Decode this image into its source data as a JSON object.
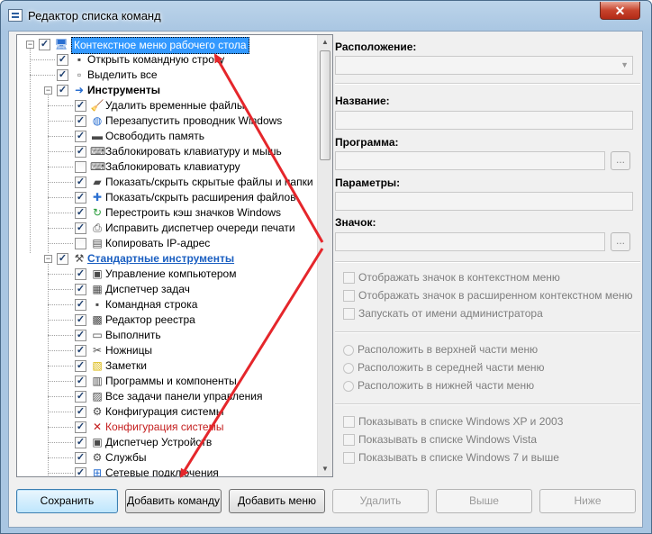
{
  "window": {
    "title": "Редактор списка команд",
    "close_label": "✕"
  },
  "tree": {
    "rows": [
      {
        "label": "Контекстное меню рабочего стола",
        "icon": "desktop-icon",
        "style": "selected"
      },
      {
        "label": "Открыть командную строку",
        "icon": "cmd-icon",
        "style": "normal"
      },
      {
        "label": "Выделить все",
        "icon": "document-icon",
        "style": "normal"
      },
      {
        "label": "Инструменты",
        "icon": "tools-arrow-icon",
        "style": "bold"
      },
      {
        "label": "Удалить временные файлы",
        "icon": "broom-icon",
        "style": "normal"
      },
      {
        "label": "Перезапустить проводник Windows",
        "icon": "globe-icon",
        "style": "normal"
      },
      {
        "label": "Освободить память",
        "icon": "memory-icon",
        "style": "normal"
      },
      {
        "label": "Заблокировать клавиатуру и мышь",
        "icon": "keyboard-mouse-icon",
        "style": "normal"
      },
      {
        "label": "Заблокировать клавиатуру",
        "icon": "keyboard-icon",
        "style": "normal"
      },
      {
        "label": "Показать/скрыть скрытые файлы и папки",
        "icon": "folder-icon",
        "style": "normal"
      },
      {
        "label": "Показать/скрыть расширения файлов",
        "icon": "puzzle-icon",
        "style": "normal"
      },
      {
        "label": "Перестроить кэш значков Windows",
        "icon": "refresh-icon",
        "style": "normal"
      },
      {
        "label": "Исправить диспетчер очереди печати",
        "icon": "printer-icon",
        "style": "normal"
      },
      {
        "label": "Копировать IP-адрес",
        "icon": "ip-icon",
        "style": "normal"
      },
      {
        "label": "Стандартные инструменты",
        "icon": "wrench-icon",
        "style": "link"
      },
      {
        "label": "Управление компьютером",
        "icon": "computer-management-icon",
        "style": "normal"
      },
      {
        "label": "Диспетчер задач",
        "icon": "task-manager-icon",
        "style": "normal"
      },
      {
        "label": "Командная строка",
        "icon": "cmd-icon",
        "style": "normal"
      },
      {
        "label": "Редактор реестра",
        "icon": "registry-icon",
        "style": "normal"
      },
      {
        "label": "Выполнить",
        "icon": "run-icon",
        "style": "normal"
      },
      {
        "label": "Ножницы",
        "icon": "scissors-icon",
        "style": "normal"
      },
      {
        "label": "Заметки",
        "icon": "sticky-note-icon",
        "style": "normal"
      },
      {
        "label": "Программы и компоненты",
        "icon": "programs-icon",
        "style": "normal"
      },
      {
        "label": "Все задачи панели управления",
        "icon": "control-panel-icon",
        "style": "normal"
      },
      {
        "label": "Конфигурация системы",
        "icon": "system-config-icon",
        "style": "normal"
      },
      {
        "label": "Конфигурация системы",
        "icon": "red-x-icon",
        "style": "red"
      },
      {
        "label": "Диспетчер Устройств",
        "icon": "device-manager-icon",
        "style": "normal"
      },
      {
        "label": "Службы",
        "icon": "services-icon",
        "style": "normal"
      },
      {
        "label": "Сетевые подключения",
        "icon": "network-icon",
        "style": "normal"
      }
    ]
  },
  "form": {
    "location_label": "Расположение:",
    "name_label": "Название:",
    "program_label": "Программа:",
    "params_label": "Параметры:",
    "icon_label": "Значок:",
    "browse_label": "...",
    "show_icon_context": "Отображать значок в контекстном меню",
    "show_icon_extended": "Отображать значок в расширенном контекстном меню",
    "run_as_admin": "Запускать от имени администратора",
    "pos_top": "Расположить в верхней части меню",
    "pos_middle": "Расположить в середней части меню",
    "pos_bottom": "Расположить в нижней части меню",
    "show_xp": "Показывать в списке Windows XP и 2003",
    "show_vista": "Показывать в списке Windows Vista",
    "show_7": "Показывать в списке Windows 7 и выше"
  },
  "buttons": {
    "save": "Сохранить",
    "add_command": "Добавить команду",
    "add_menu": "Добавить меню",
    "delete": "Удалить",
    "up": "Выше",
    "down": "Ниже"
  },
  "colors": {
    "annotation_arrow": "#e5262b",
    "selection": "#3399ff",
    "link": "#1b5fc1"
  }
}
